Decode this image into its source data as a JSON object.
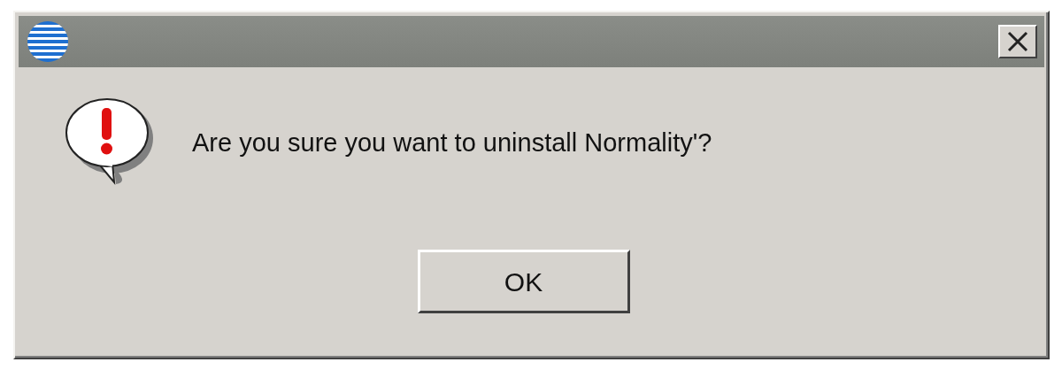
{
  "dialog": {
    "message": "Are you sure you want to uninstall Normality'?",
    "buttons": [
      {
        "label": "OK"
      }
    ]
  }
}
